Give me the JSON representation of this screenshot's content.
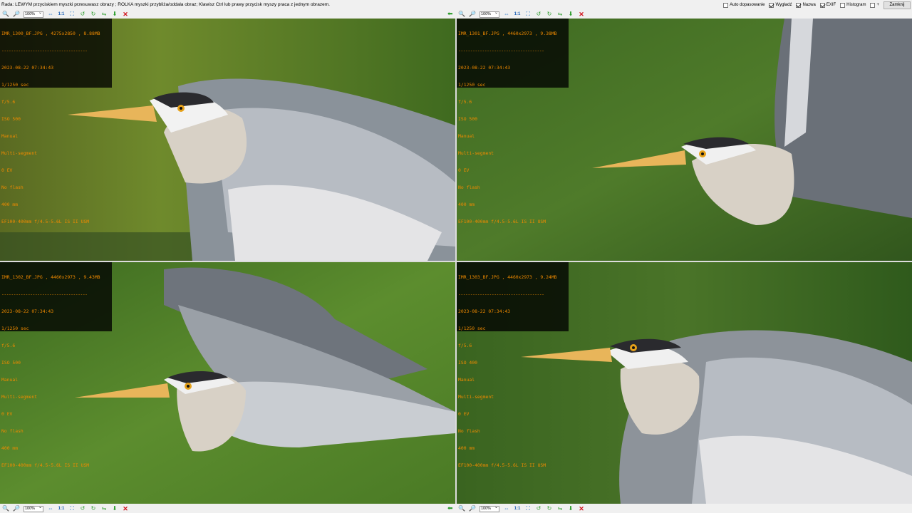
{
  "hint": "Rada: LEWYM przyciskiem myszki przesuwasz obrazy ; ROLKA myszki przybliża/oddala obraz; Klawisz Ctrl lub prawy przycisk myszy praca z jednym obrazem.",
  "options": [
    {
      "label": "Auto dopasowanie",
      "checked": false
    },
    {
      "label": "Wygładź",
      "checked": true
    },
    {
      "label": "Nazwa",
      "checked": true
    },
    {
      "label": "EXIF",
      "checked": true
    },
    {
      "label": "Histogram",
      "checked": false
    },
    {
      "label": "+",
      "checked": false
    }
  ],
  "close_label": "Zamknij",
  "toolbar": {
    "zoom_value": "100%",
    "one_to_one": "1:1",
    "icons": [
      "zoom-in-icon",
      "zoom-out-icon",
      "zoom-select",
      "fit-prev-icon",
      "one-to-one",
      "fit-window-icon",
      "rotate-left-icon",
      "rotate-right-icon",
      "flip-icon",
      "save-icon",
      "close-pane-icon"
    ]
  },
  "panes": [
    {
      "header": "IMR_1300_BF.JPG , 4275x2850 , 8.88MB",
      "separator": "------------------------------------",
      "lines": [
        "2023-08-22 07:34:43",
        "1/1250 sec",
        "f/5.6",
        "ISO 500",
        "Manual",
        "Multi-segment",
        "0 EV",
        "No flash",
        "400 mm",
        "EF100-400mm f/4.5-5.6L IS II USM"
      ]
    },
    {
      "header": "IMR_1301_BF.JPG , 4460x2973 , 9.38MB",
      "separator": "------------------------------------",
      "lines": [
        "2023-08-22 07:34:43",
        "1/1250 sec",
        "f/5.6",
        "ISO 500",
        "Manual",
        "Multi-segment",
        "0 EV",
        "No flash",
        "400 mm",
        "EF100-400mm f/4.5-5.6L IS II USM"
      ]
    },
    {
      "header": "IMR_1302_BF.JPG , 4460x2973 , 9.43MB",
      "separator": "------------------------------------",
      "lines": [
        "2023-08-22 07:34:43",
        "1/1250 sec",
        "f/5.6",
        "ISO 500",
        "Manual",
        "Multi-segment",
        "0 EV",
        "No flash",
        "400 mm",
        "EF100-400mm f/4.5-5.6L IS II USM"
      ]
    },
    {
      "header": "IMR_1303_BF.JPG , 4460x2973 , 9.24MB",
      "separator": "------------------------------------",
      "lines": [
        "2023-08-22 07:34:43",
        "1/1250 sec",
        "f/5.6",
        "ISO 400",
        "Manual",
        "Multi-segment",
        "0 EV",
        "No flash",
        "400 mm",
        "EF100-400mm f/4.5-5.6L IS II USM"
      ]
    }
  ],
  "colors": {
    "exif_text": "#f08a00",
    "close_x": "#d0121b",
    "accent": "#1b5fb5"
  }
}
